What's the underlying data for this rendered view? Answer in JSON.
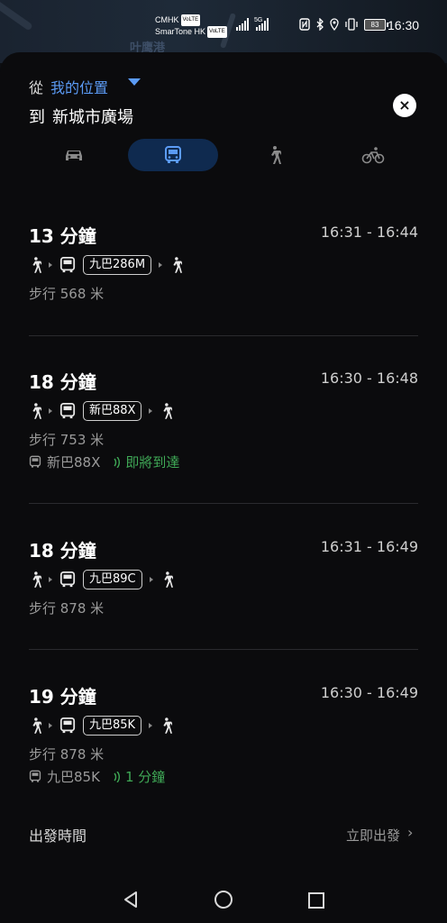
{
  "map": {
    "label": "叶鹰港"
  },
  "status_bar": {
    "carrier1": "CMHK",
    "carrier2": "SmarTone HK",
    "volte": "VoLTE",
    "net1_label": "",
    "net2_label": "5G",
    "battery": "83",
    "time": "16:30"
  },
  "directions": {
    "from_label": "從",
    "from_value": "我的位置",
    "to_label": "到",
    "to_value": "新城市廣場",
    "close_label": "×"
  },
  "modes": [
    {
      "name": "drive",
      "icon": "car-icon",
      "active": false
    },
    {
      "name": "transit",
      "icon": "bus-icon",
      "active": true
    },
    {
      "name": "walk",
      "icon": "walk-icon",
      "active": false
    },
    {
      "name": "bike",
      "icon": "bike-icon",
      "active": false
    }
  ],
  "routes": [
    {
      "duration": "13 分鐘",
      "time_range": "16:31 - 16:44",
      "bus": "九巴286M",
      "walk": "步行 568 米",
      "realtime_bus": "",
      "realtime_status": ""
    },
    {
      "duration": "18 分鐘",
      "time_range": "16:30 - 16:48",
      "bus": "新巴88X",
      "walk": "步行 753 米",
      "realtime_bus": "新巴88X",
      "realtime_status": "即將到達"
    },
    {
      "duration": "18 分鐘",
      "time_range": "16:31 - 16:49",
      "bus": "九巴89C",
      "walk": "步行 878 米",
      "realtime_bus": "",
      "realtime_status": ""
    },
    {
      "duration": "19 分鐘",
      "time_range": "16:30 - 16:49",
      "bus": "九巴85K",
      "walk": "步行 878 米",
      "realtime_bus": "九巴85K",
      "realtime_status": "1 分鐘"
    }
  ],
  "departure": {
    "label": "出發時間",
    "value": "立即出發",
    "chevron": "›"
  },
  "colors": {
    "accent_blue": "#5b9bf5",
    "live_green": "#3fa856",
    "background": "#0b0b0d"
  }
}
